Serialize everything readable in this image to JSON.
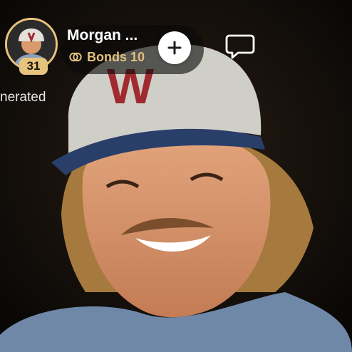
{
  "profile": {
    "name": "Morgan ...",
    "level": "31",
    "bonds": "Bonds 10"
  },
  "actions": {
    "add": "add-icon",
    "chat": "chat-icon"
  },
  "caption": "nerated",
  "colors": {
    "gold": "#e7c47e",
    "pill": "rgba(10,10,10,0.62)",
    "white": "#ffffff"
  }
}
